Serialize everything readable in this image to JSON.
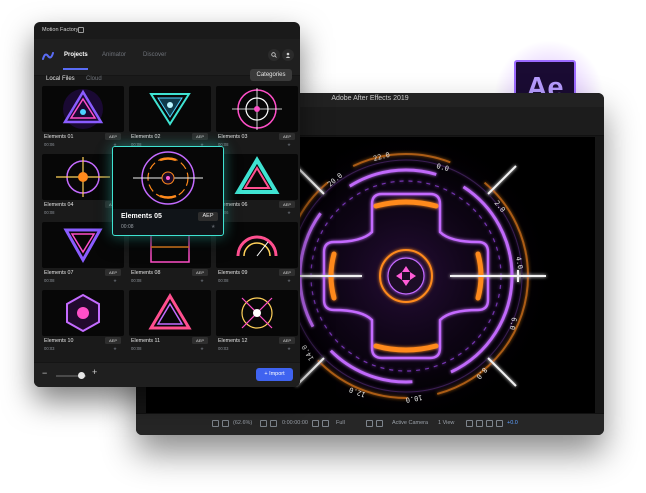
{
  "colors": {
    "accent": "#3f63f0",
    "featured_border": "#3fe3d2",
    "ae_purple": "#9c6bff",
    "hud_orange": "#ff8a1c",
    "hud_purple": "#c46bff"
  },
  "panel": {
    "title": "Motion Factory",
    "tabs": [
      "Projects",
      "Animator",
      "Discover"
    ],
    "subtabs": [
      "Local Files",
      "Cloud"
    ],
    "categories_label": "Categories",
    "import_label": "+ Import",
    "items": [
      {
        "name": "Elements 01",
        "duration": "00:06",
        "badge": "AEP",
        "icon": "triangle-portal-icon"
      },
      {
        "name": "Elements 02",
        "duration": "00:08",
        "badge": "AEP",
        "icon": "inverted-triangle-icon"
      },
      {
        "name": "Elements 03",
        "duration": "00:08",
        "badge": "AEP",
        "icon": "target-ring-icon"
      },
      {
        "name": "Elements 04",
        "duration": "00:08",
        "badge": "AEP",
        "icon": "crosshair-icon"
      },
      {
        "name": "Elements 05",
        "duration": "00:08",
        "badge": "AEP",
        "icon": "hud-circle-icon"
      },
      {
        "name": "Elements 06",
        "duration": "00:06",
        "badge": "AEP",
        "icon": "penrose-triangle-icon"
      },
      {
        "name": "Elements 07",
        "duration": "00:08",
        "badge": "AEP",
        "icon": "impossible-triangle-icon"
      },
      {
        "name": "Elements 08",
        "duration": "00:08",
        "badge": "AEP",
        "icon": "hex-frame-icon"
      },
      {
        "name": "Elements 09",
        "duration": "00:08",
        "badge": "AEP",
        "icon": "half-circle-gauge-icon"
      },
      {
        "name": "Elements 10",
        "duration": "00:03",
        "badge": "AEP",
        "icon": "hexagon-orb-icon"
      },
      {
        "name": "Elements 11",
        "duration": "00:08",
        "badge": "AEP",
        "icon": "glowing-triangle-icon"
      },
      {
        "name": "Elements 12",
        "duration": "00:03",
        "badge": "AEP",
        "icon": "starburst-icon"
      }
    ],
    "featured": {
      "name": "Elements 05",
      "duration": "00:08",
      "badge": "AEP"
    }
  },
  "ae": {
    "title": "Adobe After Effects 2019",
    "logo_text": "Ae",
    "hud_labels": [
      "22.0",
      "20.0",
      "0.0",
      "2.0",
      "4.0",
      "6.0",
      "8.0",
      "10.0",
      "12.0",
      "14.0"
    ],
    "footer": {
      "zoom": "(62.6%)",
      "timecode": "0:00:00:00",
      "resolution": "Full",
      "camera": "Active Camera",
      "views": "1 View",
      "offset": "+0.0"
    }
  }
}
